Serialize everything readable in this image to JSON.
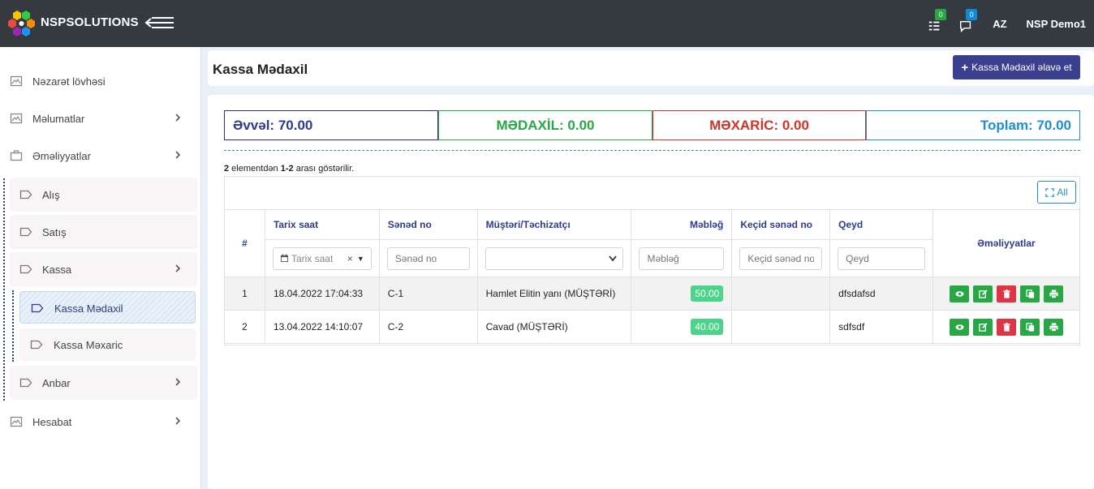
{
  "app": {
    "brand": "NSPSOLUTIONS",
    "language": "AZ",
    "user": "NSP Demo1"
  },
  "notifications": {
    "tasks_count": "0",
    "messages_count": "0"
  },
  "sidebar": {
    "items": [
      {
        "label": "Nəzarət lövhəsi"
      },
      {
        "label": "Məlumatlar"
      },
      {
        "label": "Əməliyyatlar"
      },
      {
        "label": "Hesabat"
      }
    ],
    "sub": [
      {
        "label": "Alış"
      },
      {
        "label": "Satış"
      },
      {
        "label": "Kassa"
      },
      {
        "label": "Anbar"
      }
    ],
    "kassa_sub": [
      {
        "label": "Kassa Mədaxil"
      },
      {
        "label": "Kassa Məxaric"
      }
    ]
  },
  "page": {
    "title": "Kassa Mədaxil",
    "add_button": "Kassa Mədaxil əlavə et"
  },
  "summary": {
    "prev": "Əvvəl: 70.00",
    "income": "MƏDAXİL: 0.00",
    "expense": "MƏXARİC: 0.00",
    "total": "Toplam: 70.00"
  },
  "table_info": {
    "count": "2",
    "pre": " elementdən ",
    "range": "1-2",
    "post": " arası göstərilir."
  },
  "table": {
    "all_button": "All",
    "columns": [
      "#",
      "Tarix saat",
      "Sənəd no",
      "Müştəri/Təchizatçı",
      "Məbləğ",
      "Keçid sənəd no",
      "Qeyd",
      "Əməliyyatlar"
    ],
    "filters": {
      "date_placeholder": "Tarix saat",
      "doc_placeholder": "Sənəd no",
      "amount_placeholder": "Məbləğ",
      "link_placeholder": "Keçid sənəd no",
      "note_placeholder": "Qeyd"
    },
    "rows": [
      {
        "num": "1",
        "date": "18.04.2022 17:04:33",
        "doc": "C-1",
        "client": "Hamlet Elitin yanı (MÜŞTƏRİ)",
        "amount": "50.00",
        "link": "",
        "note": "dfsdafsd"
      },
      {
        "num": "2",
        "date": "13.04.2022 14:10:07",
        "doc": "C-2",
        "client": "Cavad (MÜŞTƏRİ)",
        "amount": "40.00",
        "link": "",
        "note": "sdfsdf"
      }
    ]
  },
  "colors": {
    "topbar": "#343a40",
    "primary": "#3a3f8f",
    "success": "#28a745",
    "danger": "#dc3545",
    "info": "#1f8dd6"
  }
}
